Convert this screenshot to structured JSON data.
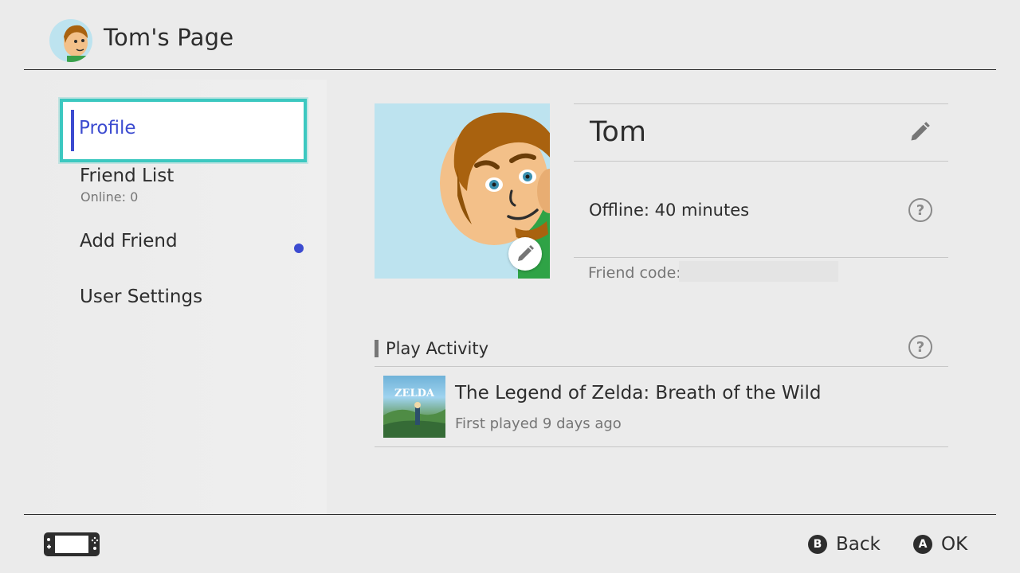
{
  "header": {
    "title": "Tom's Page",
    "avatar_icon": "mii-avatar-icon"
  },
  "sidebar": {
    "items": [
      {
        "label": "Profile",
        "selected": true
      },
      {
        "label": "Friend List",
        "sublabel": "Online: 0"
      },
      {
        "label": "Add Friend",
        "has_notification": true
      },
      {
        "label": "User Settings"
      }
    ]
  },
  "profile": {
    "name": "Tom",
    "status": "Offline: 40 minutes",
    "friend_code_label": "Friend code:",
    "edit_icon": "pencil-icon",
    "help_icon": "question-mark-icon"
  },
  "activity": {
    "title": "Play Activity",
    "games": [
      {
        "title": "The Legend of Zelda: Breath of the Wild",
        "subtitle": "First played 9 days ago",
        "thumb_text": "ZELDA"
      }
    ]
  },
  "footer": {
    "console_icon": "handheld-console-icon",
    "buttons": [
      {
        "glyph": "B",
        "label": "Back"
      },
      {
        "glyph": "A",
        "label": "OK"
      }
    ]
  },
  "colors": {
    "accent_blue": "#3c4bd0",
    "focus_teal": "#3cc8c0",
    "mii_background": "#bde3ef"
  }
}
